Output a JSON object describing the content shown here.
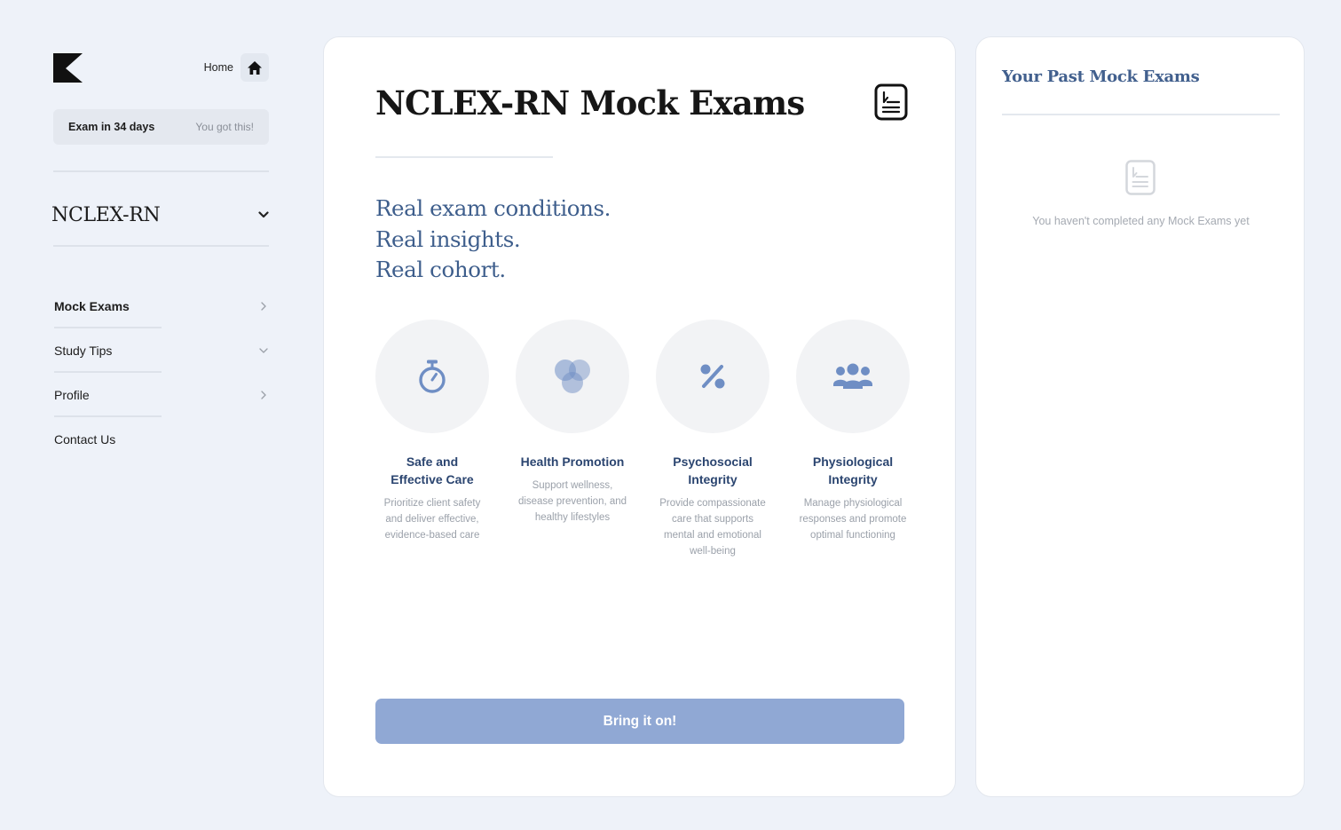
{
  "sidebar": {
    "logo_icon": "k-logo-icon",
    "home_label": "Home",
    "home_icon": "home-icon",
    "exam_countdown": "Exam in 34 days",
    "exam_message": "You got this!",
    "course_name": "NCLEX-RN",
    "course_chevron_icon": "chevron-down-icon",
    "nav": [
      {
        "label": "Mock Exams",
        "icon": "chevron-right-icon",
        "active": true
      },
      {
        "label": "Study Tips",
        "icon": "chevron-down-icon",
        "active": false
      },
      {
        "label": "Profile",
        "icon": "chevron-right-icon",
        "active": false
      },
      {
        "label": "Contact Us",
        "icon": "",
        "active": false
      }
    ]
  },
  "main": {
    "title": "NCLEX-RN Mock Exams",
    "title_icon": "document-list-icon",
    "tagline": [
      "Real exam conditions.",
      "Real insights.",
      "Real cohort."
    ],
    "features": [
      {
        "title": "Safe and Effective Care",
        "description": "Prioritize client safety and deliver effective, evidence-based care",
        "icon": "stopwatch-icon"
      },
      {
        "title": "Health Promotion",
        "description": "Support wellness, disease prevention, and healthy lifestyles",
        "icon": "venn-circles-icon"
      },
      {
        "title": "Psychosocial Integrity",
        "description": "Provide compassionate care that supports mental and emotional well-being",
        "icon": "percent-icon"
      },
      {
        "title": "Physiological Integrity",
        "description": "Manage physiological responses and promote optimal functioning",
        "icon": "group-icon"
      }
    ],
    "cta_label": "Bring it on!"
  },
  "past_exams": {
    "title": "Your Past Mock Exams",
    "empty_icon": "document-icon",
    "empty_message": "You haven't completed any Mock Exams yet"
  },
  "colors": {
    "background": "#eef2f9",
    "accent_text": "#3e5e8c",
    "feature_title": "#2b4570",
    "icon_blue": "#6f8ec4",
    "cta_background": "#90a8d4"
  }
}
